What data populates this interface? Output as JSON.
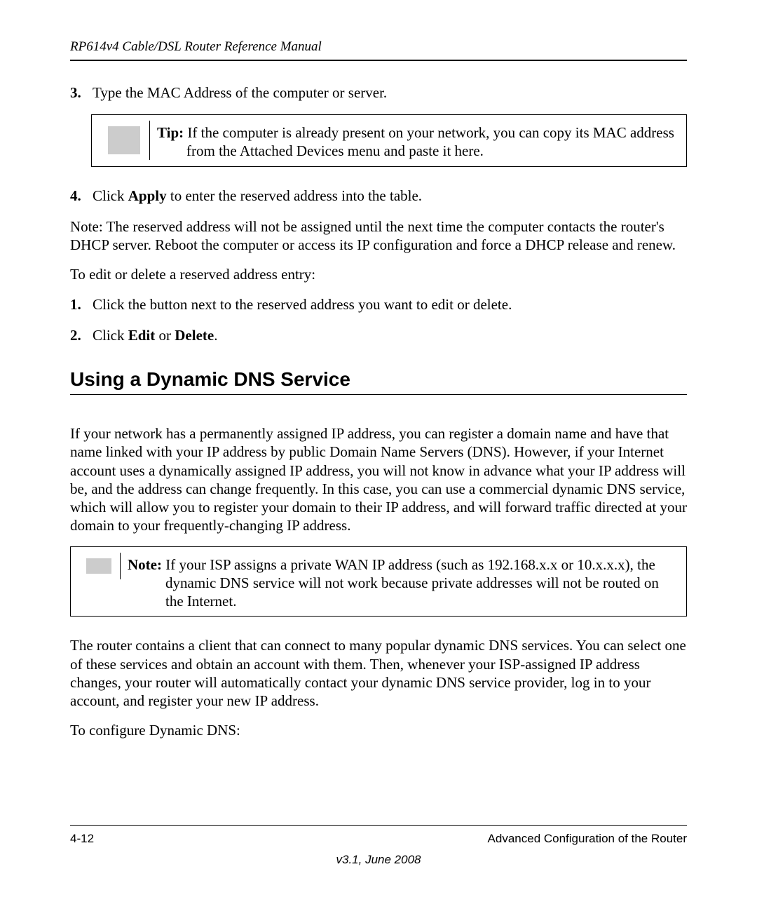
{
  "header": {
    "title": "RP614v4 Cable/DSL Router Reference Manual"
  },
  "list_a": {
    "items": [
      {
        "num": "3.",
        "text": "Type the MAC Address of the computer or server."
      },
      {
        "num": "4.",
        "prefix": "Click ",
        "bold": "Apply",
        "suffix": " to enter the reserved address into the table."
      }
    ]
  },
  "tip": {
    "label": "Tip:",
    "text": " If the computer is already present on your network, you can copy its MAC address from the Attached Devices menu and paste it here."
  },
  "para_note": "Note: The reserved address will not be assigned until the next time the computer contacts the router's DHCP server. Reboot the computer or access its IP configuration and force a DHCP release and renew.",
  "para_edit_intro": "To edit or delete a reserved address entry:",
  "list_b": {
    "items": [
      {
        "num": "1.",
        "text": "Click the button next to the reserved address you want to edit or delete."
      },
      {
        "num": "2.",
        "prefix": "Click ",
        "bold1": "Edit",
        "mid": " or ",
        "bold2": "Delete",
        "suffix": "."
      }
    ]
  },
  "section_heading": "Using a Dynamic DNS Service",
  "para_ddns_1": "If your network has a permanently assigned IP address, you can register a domain name and have that name linked with your IP address by public Domain Name Servers (DNS). However, if your Internet account uses a dynamically assigned IP address, you will not know in advance what your IP address will be, and the address can change frequently. In this case, you can use a commercial dynamic DNS service, which will allow you to register your domain to their IP address, and will forward traffic directed at your domain to your frequently-changing IP address.",
  "note": {
    "label": "Note:",
    "text": " If your ISP assigns a private WAN IP address (such as 192.168.x.x or 10.x.x.x), the dynamic DNS service will not work because private addresses will not be routed on the Internet."
  },
  "para_ddns_2": "The router contains a client that can connect to many popular dynamic DNS services. You can select one of these services and obtain an account with them. Then, whenever your ISP-assigned IP address changes, your router will automatically contact your dynamic DNS service provider, log in to your account, and register your new IP address.",
  "para_ddns_3": "To configure Dynamic DNS:",
  "footer": {
    "page": "4-12",
    "chapter": "Advanced Configuration of the Router",
    "version": "v3.1, June 2008"
  }
}
